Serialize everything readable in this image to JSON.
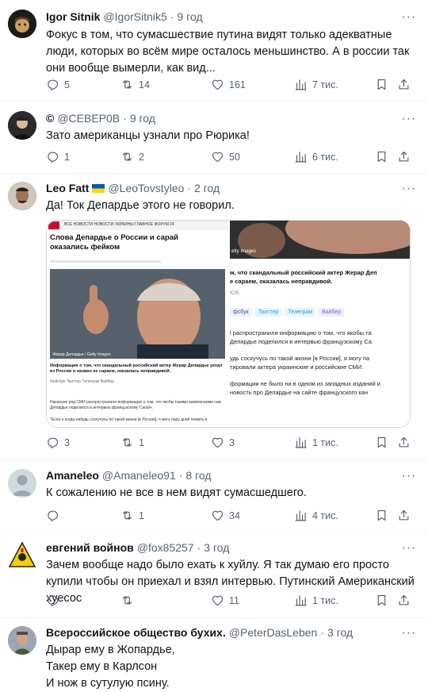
{
  "tweets": [
    {
      "name": "Igor Sitnik",
      "handle": "@IgorSitnik5",
      "time": "9 год",
      "text": "Фокус в том, что сумасшествие путина видят только адекватные люди, которых во всём мире осталось меньшинство. А в россии так они вообще вымерли, как вид...",
      "replies": "5",
      "retweets": "14",
      "likes": "161",
      "views": "7 тис."
    },
    {
      "name": "©",
      "handle": "@СЕВЕР0В",
      "time": "9 год",
      "text": "Зато американцы узнали про Рюрика!",
      "replies": "1",
      "retweets": "2",
      "likes": "50",
      "views": "6 тис."
    },
    {
      "name": "Leo Fatt",
      "handle": "@LeoTovstyleo",
      "time": "2 год",
      "text": "Да! Ток Депардье этого не говорил.",
      "replies": "3",
      "retweets": "1",
      "likes": "3",
      "views": "1 тис.",
      "media": {
        "headline_line1": "Слова Депардье о России и сарай",
        "headline_line2": "оказались фейком",
        "nav": "ВСЕ НОВОСТИ   НОВОСТИ УКРАИНЫ   ГЛАВНОЕ   ФОРУМ 24",
        "caption": "Жерар Депардье / Getty Images",
        "sub_left": "Информация о том, что скандальный российский актер Жерар Депардье уехал из России и назвал ее сараем, оказалась неправдивой.",
        "share_left": "Фейсбук   Твиттер   Телеграм   Вайбер",
        "body_left": "Накануне ряд СМИ распространили информацию о том, что якобы такими заявлениями сам Депардье поделился в интервью французскому Canal+.",
        "quote_left": "\"Если я когда-нибудь соскучусь по такой жизни [в России], я могу пару дней помить в",
        "getty": "etty Images",
        "right_l1": "м, что скандальный российский актер Жерар Деп",
        "right_l2": "е сараем, оказалась неправдивой.",
        "right_l3": "ЮВ",
        "share_right": [
          "фсбук",
          "Твиттер",
          "Телеграм",
          "Вайбер"
        ],
        "right_b1": "l распространили информацию о том, что якобы та",
        "right_b2": "Депардье поделился в интервью французскому Са",
        "right_b3": "удь соскучусь по такой жизни [в России], я могу па",
        "right_b4": "тировали актера украинские и российские СМИ.",
        "right_b5": "формации не было ни в одном из западных изданий и",
        "right_b6": "новость про Депардье на сайте французского кан"
      }
    },
    {
      "name": "Amaneleo",
      "handle": "@Amaneleo91",
      "time": "8 год",
      "text": "К сожалению не все в нем видят сумасшедшего.",
      "replies": "",
      "retweets": "1",
      "likes": "34",
      "views": "4 тис."
    },
    {
      "name": "евгений войнов",
      "handle": "@fox85257",
      "time": "3 год",
      "text": "Зачем вообще надо было ехать к хуйлу. Я так думаю его просто купили чтобы он приехал и взял интервью. Путинский Американский хуесос",
      "replies": "",
      "retweets": "",
      "likes": "11",
      "views": "1 тис."
    },
    {
      "name": "Всероссийское общество бухих.",
      "handle": "@PeterDasLeben",
      "time": "3 год",
      "text_lines": [
        "Дырар ему в Жопардье,",
        "Такер ему в Карлсон",
        "И нож в сутулую псину."
      ]
    }
  ],
  "icons": {
    "reply": "reply-icon",
    "retweet": "retweet-icon",
    "like": "heart-icon",
    "views": "views-bar-chart-icon",
    "bookmark": "bookmark-icon",
    "share": "share-icon",
    "more": "more-dots-icon"
  },
  "colors": {
    "text": "#0f1419",
    "secondary": "#536471",
    "divider": "#eff3f4",
    "tweet_red": "#c8102e"
  }
}
